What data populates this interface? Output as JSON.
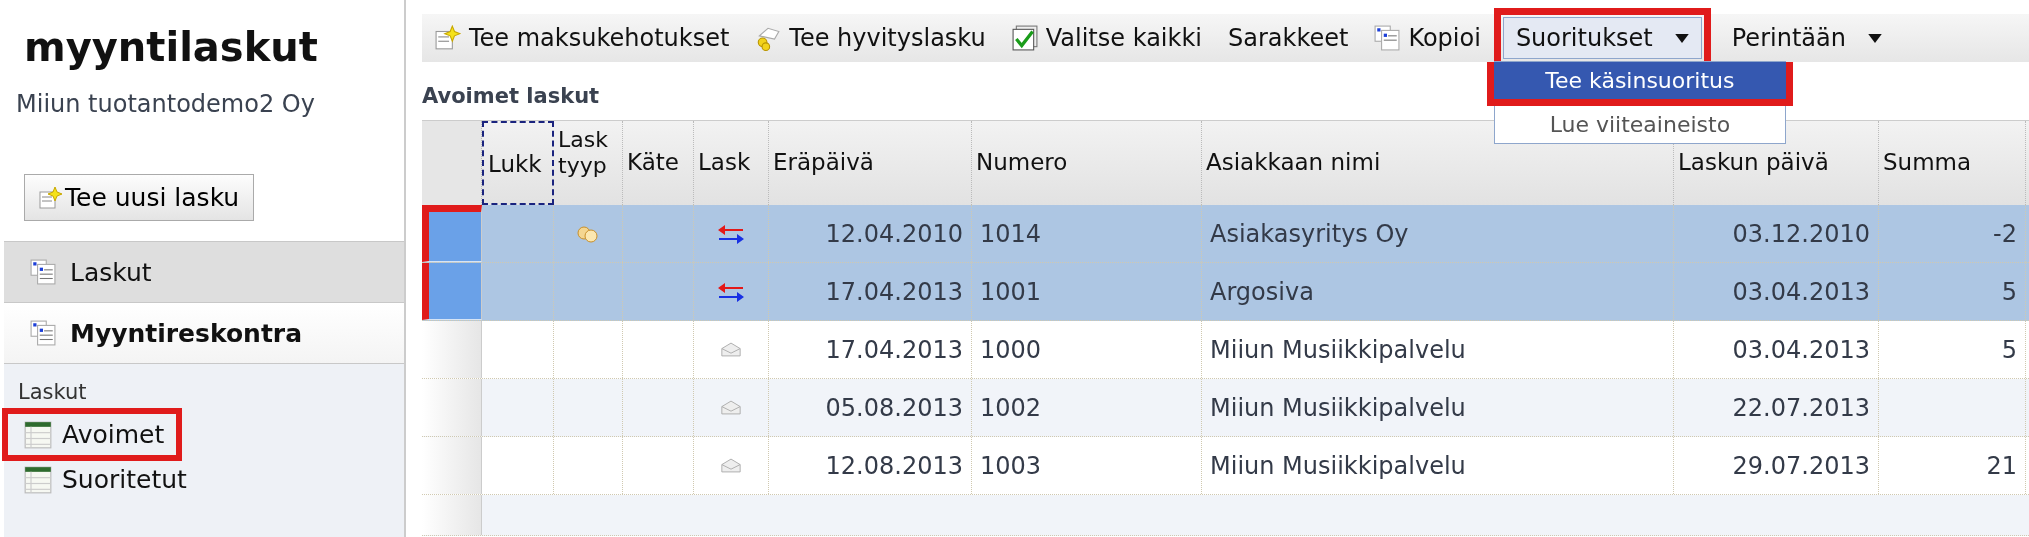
{
  "sidebar": {
    "title": "myyntilaskut",
    "company": "Miiun tuotantodemo2 Oy",
    "new_button": "Tee uusi lasku",
    "sections": [
      {
        "label": "Laskut",
        "selected": false
      },
      {
        "label": "Myyntireskontra",
        "selected": true
      }
    ],
    "group_label": "Laskut",
    "items": [
      {
        "label": "Avoimet",
        "highlighted": true
      },
      {
        "label": "Suoritetut",
        "highlighted": false
      }
    ]
  },
  "toolbar": [
    {
      "kind": "new",
      "label": "Tee maksukehotukset"
    },
    {
      "kind": "credit",
      "label": "Tee hyvityslasku"
    },
    {
      "kind": "check",
      "label": "Valitse kaikki"
    },
    {
      "kind": "plain",
      "label": "Sarakkeet"
    },
    {
      "kind": "copy",
      "label": "Kopioi"
    },
    {
      "kind": "dropdown",
      "label": "Suoritukset",
      "expanded": true,
      "highlighted": true,
      "menu": [
        {
          "label": "Tee käsinsuoritus",
          "selected": true
        },
        {
          "label": "Lue viiteaineisto",
          "selected": false
        }
      ]
    },
    {
      "kind": "dropdown",
      "label": "Perintään",
      "expanded": false,
      "highlighted": false
    }
  ],
  "table": {
    "title": "Avoimet laskut",
    "columns": [
      "Lukk",
      "Lask tyyp",
      "Käte",
      "Lask",
      "Eräpäivä",
      "Numero",
      "Asiakkaan nimi",
      "Laskun päivä",
      "Summa"
    ],
    "rows": [
      {
        "selected": true,
        "highlighted": true,
        "type_icon": {
          "kind": "coins"
        },
        "status_icon": {
          "kind": "exchange"
        },
        "due": "12.04.2010",
        "number": "1014",
        "customer": "Asiakasyritys Oy",
        "date": "03.12.2010",
        "sum": "-2"
      },
      {
        "selected": true,
        "highlighted": true,
        "status_icon": {
          "kind": "exchange"
        },
        "due": "17.04.2013",
        "number": "1001",
        "customer": "Argosiva",
        "date": "03.04.2013",
        "sum": "5"
      },
      {
        "selected": false,
        "highlighted": false,
        "status_icon": {
          "kind": "envelope"
        },
        "due": "17.04.2013",
        "number": "1000",
        "customer": "Miiun Musiikkipalvelu",
        "date": "03.04.2013",
        "sum": "5"
      },
      {
        "selected": false,
        "highlighted": false,
        "status_icon": {
          "kind": "envelope"
        },
        "due": "05.08.2013",
        "number": "1002",
        "customer": "Miiun Musiikkipalvelu",
        "date": "22.07.2013",
        "sum": ""
      },
      {
        "selected": false,
        "highlighted": false,
        "status_icon": {
          "kind": "envelope"
        },
        "due": "12.08.2013",
        "number": "1003",
        "customer": "Miiun Musiikkipalvelu",
        "date": "29.07.2013",
        "sum": "21"
      }
    ]
  }
}
